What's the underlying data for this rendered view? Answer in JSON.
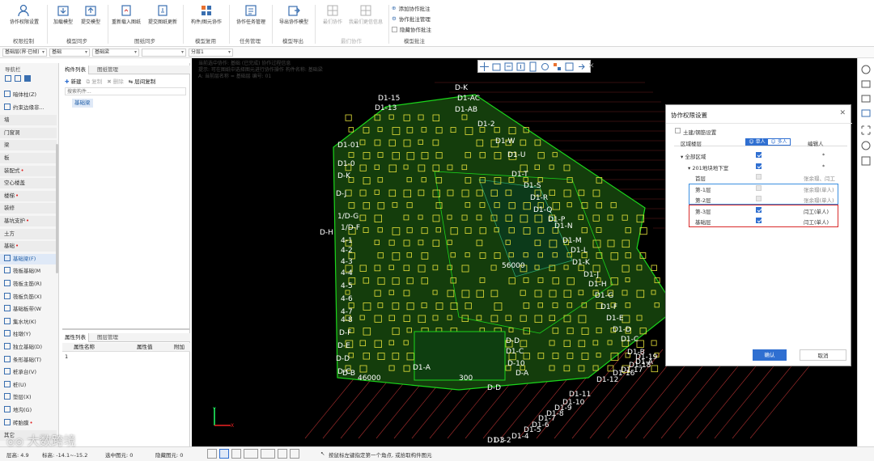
{
  "ribbon": {
    "groups": [
      {
        "label": "权限控制",
        "buttons": [
          {
            "label": "协作权限设置"
          }
        ]
      },
      {
        "label": "模型同步",
        "buttons": [
          {
            "label": "加载模型"
          },
          {
            "label": "提交模型"
          }
        ]
      },
      {
        "label": "图纸同步",
        "buttons": [
          {
            "label": "重新载入图纸"
          },
          {
            "label": "提交图纸更新"
          }
        ]
      },
      {
        "label": "模型复用",
        "buttons": [
          {
            "label": "构件/图元协作"
          }
        ]
      },
      {
        "label": "任务管理",
        "buttons": [
          {
            "label": "协作任务管理"
          }
        ]
      },
      {
        "label": "模型导出",
        "buttons": [
          {
            "label": "导出协作模型"
          }
        ]
      },
      {
        "label": "最们协作",
        "buttons": [
          {
            "label": "最们协作"
          },
          {
            "label": "我最们更信信息"
          }
        ]
      },
      {
        "label": "模型批注",
        "small": [
          "添加协作批注",
          "协作批注管理",
          "隐藏协作批注"
        ]
      }
    ]
  },
  "selectors": [
    "基础层(界·已帧)",
    "基础",
    "基础梁",
    "",
    "分层1"
  ],
  "nav": {
    "title": "导航栏",
    "items": [
      {
        "label": "暗体柱(Z)",
        "type": "item"
      },
      {
        "label": "约束边缘非...",
        "type": "item"
      },
      {
        "label": "墙",
        "type": "cat"
      },
      {
        "label": "门窗洞",
        "type": "cat"
      },
      {
        "label": "梁",
        "type": "cat"
      },
      {
        "label": "板",
        "type": "cat"
      },
      {
        "label": "装配式",
        "type": "cat",
        "dot": true
      },
      {
        "label": "空心楼盖",
        "type": "cat"
      },
      {
        "label": "楼梯",
        "type": "cat",
        "dot": true
      },
      {
        "label": "装修",
        "type": "cat"
      },
      {
        "label": "基坑支护",
        "type": "cat",
        "dot": true
      },
      {
        "label": "土方",
        "type": "cat"
      },
      {
        "label": "基础",
        "type": "cat",
        "dot": true
      },
      {
        "label": "基础梁(F)",
        "type": "item",
        "selected": true
      },
      {
        "label": "筏板基础(M",
        "type": "item"
      },
      {
        "label": "筏板主筋(R)",
        "type": "item"
      },
      {
        "label": "筏板负筋(X)",
        "type": "item"
      },
      {
        "label": "基础板带(W",
        "type": "item"
      },
      {
        "label": "集水坑(K)",
        "type": "item"
      },
      {
        "label": "柱墩(Y)",
        "type": "item"
      },
      {
        "label": "独立基础(D)",
        "type": "item"
      },
      {
        "label": "条形基础(T)",
        "type": "item"
      },
      {
        "label": "桩承台(V)",
        "type": "item"
      },
      {
        "label": "桩(U)",
        "type": "item"
      },
      {
        "label": "垫层(X)",
        "type": "item"
      },
      {
        "label": "地沟(G)",
        "type": "item"
      },
      {
        "label": "砖胎膜",
        "type": "item",
        "dot": true
      },
      {
        "label": "其它",
        "type": "cat"
      }
    ]
  },
  "components": {
    "tabs": [
      "构件列表",
      "图纸管理"
    ],
    "toolbar": [
      "新建",
      "复制",
      "删除",
      "层间复制"
    ],
    "search_placeholder": "搜索构件...",
    "item": "基础梁"
  },
  "properties": {
    "tabs": [
      "属性列表",
      "图层管理"
    ],
    "headers": [
      "属性名称",
      "属性值",
      "附加"
    ],
    "row1": "1"
  },
  "canvas": {
    "info_lines": [
      "当前选中协作: 基础 (已完成) 协作过程信息",
      "提示: 可在图纸中选择图元进行协作操作 构件名称: 基础梁",
      "A: 当前层名称 = 基础层 编号: 01"
    ],
    "axis_labels": [
      "D-K",
      "D1-AC",
      "D1-AB",
      "D1-15",
      "D1-13",
      "D1-2",
      "D1-W",
      "D1-U",
      "D1-T",
      "D1-S",
      "D1-R",
      "D1-Q",
      "D1-P",
      "D1-N",
      "D1-M",
      "D1-L",
      "D1-K",
      "D1-J",
      "D1-H",
      "D1-G",
      "D1-F",
      "D1-E",
      "D1-D",
      "D1-C",
      "D1-B",
      "D1-A",
      "D1-19",
      "D1-18",
      "D1-17",
      "D1-16",
      "D1-12",
      "D1-11",
      "D1-10",
      "D1-9",
      "D1-8",
      "D1-7",
      "D1-6",
      "D1-5",
      "D1-4",
      "D1-3",
      "D1-2",
      "D1-01",
      "D1-0",
      "D-K",
      "D-J",
      "D-H",
      "1/D-G",
      "1/D-F",
      "4-1",
      "4-2",
      "4-3",
      "4-4",
      "4-5",
      "4-6",
      "4-7",
      "4-8",
      "D-F",
      "D-E",
      "D-D",
      "D-C",
      "D-B",
      "D-A",
      "D-D",
      "D-10",
      "D-D",
      "D1-C",
      "D1-A",
      "300",
      "46000",
      "56000"
    ]
  },
  "dialog": {
    "title": "协作权限设置",
    "checkbox_label": "土建/钢筋设置",
    "col_area": "区域楼层",
    "col_editor": "编辑人",
    "single": "单人",
    "multi": "多人",
    "tree": [
      {
        "label": "全部区域",
        "indent": 0,
        "checked": "on",
        "editor": "*"
      },
      {
        "label": "201地块地下室",
        "indent": 1,
        "checked": "on",
        "editor": "*"
      },
      {
        "label": "首层",
        "indent": 2,
        "checked": "dis",
        "editor": "张余璟、闫工"
      },
      {
        "label": "第-1层",
        "indent": 2,
        "checked": "dis",
        "editor": "张余璟(单人)",
        "box": "blue"
      },
      {
        "label": "第-2层",
        "indent": 2,
        "checked": "dis",
        "editor": "张余璟(单人)",
        "box": "blue"
      },
      {
        "label": "第-3层",
        "indent": 2,
        "checked": "on",
        "editor": "闫工(单人)",
        "box": "red"
      },
      {
        "label": "基础层",
        "indent": 2,
        "checked": "on",
        "editor": "闫工(单人)",
        "box": "red"
      }
    ],
    "ok": "确认",
    "cancel": "取消"
  },
  "status": {
    "items": [
      "层高: 4.9",
      "标高: -14.1~-15.2",
      "选中图元: 0",
      "隐藏图元: 0"
    ],
    "hint": "按鼠标左键指定第一个角点, 或拾取构件图元"
  },
  "watermark": "大数跨境",
  "colors": {
    "accent": "#2f6fd1",
    "blue_box": "#3b8fe0",
    "red_box": "#d92b2b",
    "plan_green": "#1bd61b",
    "plan_yellow": "#e7e23a",
    "plan_red": "#d23a3a"
  }
}
